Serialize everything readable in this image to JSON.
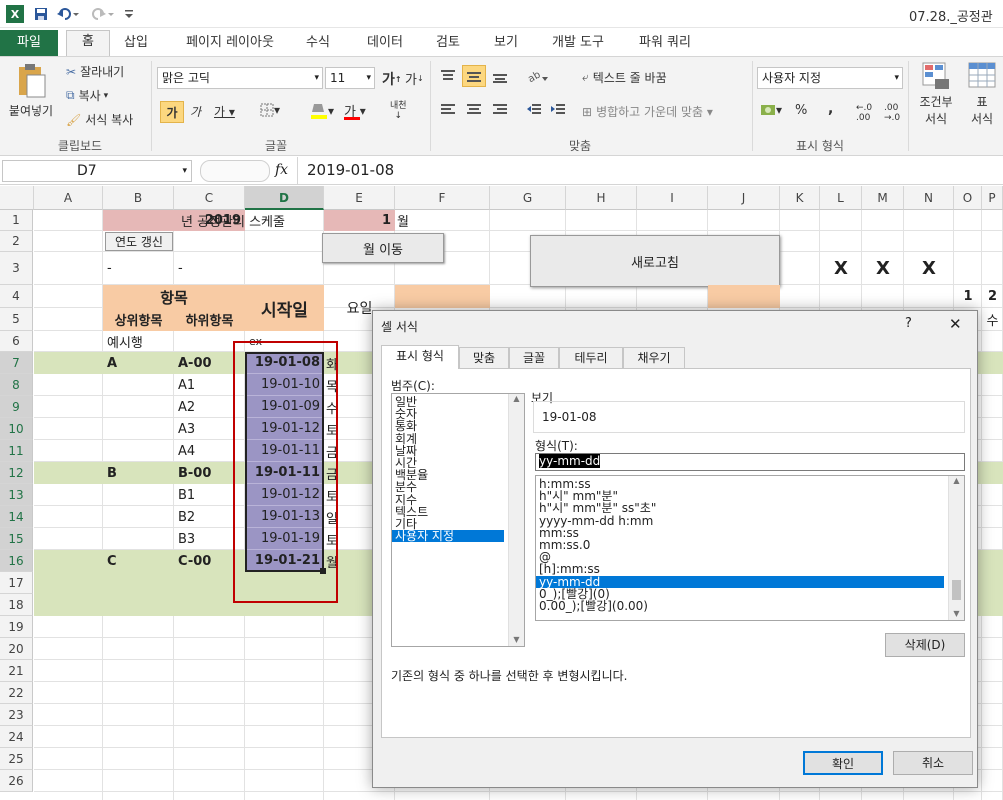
{
  "title": {
    "text": "07.28._공정관리"
  },
  "tabs": [
    "파일",
    "홈",
    "삽입",
    "페이지 레이아웃",
    "수식",
    "데이터",
    "검토",
    "보기",
    "개발 도구",
    "파워 쿼리"
  ],
  "ribbon": {
    "paste": "붙여넣기",
    "cut": "잘라내기",
    "copy": "복사",
    "format_painter": "서식 복사",
    "clipboard": "클립보드",
    "font_name": "맑은 고딕",
    "font_size": "11",
    "font_group": "글꼴",
    "wrap_text": "텍스트 줄 바꿈",
    "merge_center": "병합하고 가운데 맞춤",
    "align_group": "맞춤",
    "number_format": "사용자 지정",
    "number_group": "표시 형식",
    "cond_format": "조건부\n서식",
    "cond_format_l1": "조건부",
    "cond_format_l2": "서식",
    "table_format_l1": "표",
    "table_format_l2": "서식"
  },
  "formula_bar": {
    "name_box": "D7",
    "fx": "fx",
    "value": "2019-01-08"
  },
  "columns": [
    "A",
    "B",
    "C",
    "D",
    "E",
    "F",
    "G",
    "H",
    "I",
    "J",
    "K",
    "L",
    "M",
    "N",
    "O",
    "P"
  ],
  "rows": [
    "1",
    "2",
    "3",
    "4",
    "5",
    "6",
    "7",
    "8",
    "9",
    "10",
    "11",
    "12",
    "13",
    "14",
    "15",
    "16",
    "17",
    "18",
    "19",
    "20",
    "21",
    "22",
    "23",
    "24",
    "25",
    "26"
  ],
  "sheet": {
    "year": "2019",
    "year_label": "년 공정관리 스케줄",
    "month": "1",
    "month_label": "월",
    "year_update_btn": "연도 갱신",
    "month_move_btn": "월 이동",
    "refresh_btn": "새로고침",
    "dash1": "-",
    "dash2": "-",
    "xmarks": [
      "X",
      "X",
      "X"
    ],
    "header_item": "항목",
    "header_parent": "상위항목",
    "header_child": "하위항목",
    "header_start": "시작일",
    "header_dow": "요일",
    "day_nums": [
      "1",
      "2"
    ],
    "day_dow": "수",
    "example_row": "예시행",
    "example_ex": "ex",
    "data": [
      {
        "parent": "A",
        "child": "A-00",
        "date": "19-01-08",
        "dow": "화"
      },
      {
        "parent": "",
        "child": "A1",
        "date": "19-01-10",
        "dow": "목"
      },
      {
        "parent": "",
        "child": "A2",
        "date": "19-01-09",
        "dow": "수"
      },
      {
        "parent": "",
        "child": "A3",
        "date": "19-01-12",
        "dow": "토"
      },
      {
        "parent": "",
        "child": "A4",
        "date": "19-01-11",
        "dow": "금"
      },
      {
        "parent": "B",
        "child": "B-00",
        "date": "19-01-11",
        "dow": "금"
      },
      {
        "parent": "",
        "child": "B1",
        "date": "19-01-12",
        "dow": "토"
      },
      {
        "parent": "",
        "child": "B2",
        "date": "19-01-13",
        "dow": "일"
      },
      {
        "parent": "",
        "child": "B3",
        "date": "19-01-19",
        "dow": "토"
      },
      {
        "parent": "C",
        "child": "C-00",
        "date": "19-01-21",
        "dow": "월"
      }
    ]
  },
  "dialog": {
    "title": "셀 서식",
    "help": "?",
    "close": "✕",
    "tabs": [
      "표시 형식",
      "맞춤",
      "글꼴",
      "테두리",
      "채우기"
    ],
    "category_label": "범주(C):",
    "categories": [
      "일반",
      "숫자",
      "통화",
      "회계",
      "날짜",
      "시간",
      "백분율",
      "분수",
      "지수",
      "텍스트",
      "기타",
      "사용자 지정"
    ],
    "selected_category": "사용자 지정",
    "sample_label": "보기",
    "sample_value": "19-01-08",
    "type_label": "형식(T):",
    "type_value": "yy-mm-dd",
    "formats": [
      "h:mm:ss",
      "h\"시\" mm\"분\"",
      "h\"시\" mm\"분\" ss\"초\"",
      "yyyy-mm-dd h:mm",
      "mm:ss",
      "mm:ss.0",
      "@",
      "[h]:mm:ss",
      "yy-mm-dd",
      "0_);[빨강](0)",
      "0.00_);[빨강](0.00)"
    ],
    "selected_format": "yy-mm-dd",
    "delete_btn": "삭제(D)",
    "description": "기존의 형식 중 하나를 선택한 후 변형시킵니다.",
    "ok_btn": "확인",
    "cancel_btn": "취소"
  },
  "colors": {
    "excel_green": "#217346",
    "header_orange": "#f8cba4",
    "year_pink": "#e6b8b7",
    "group_green": "#d8e4bc",
    "selection_purple": "#9b95c4",
    "selection_border": "#c00000",
    "listbox_selected": "#0078d7"
  }
}
